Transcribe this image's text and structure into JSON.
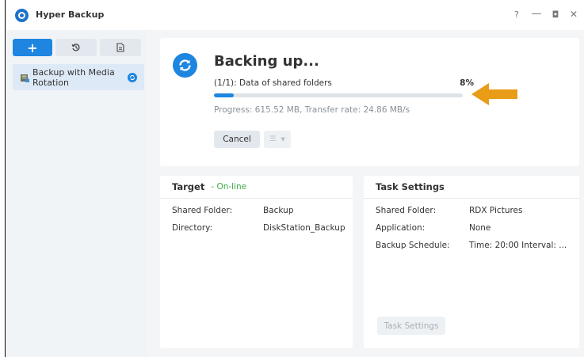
{
  "window": {
    "title": "Hyper Backup",
    "help": "?",
    "minimize": "—",
    "maximize": "◘",
    "close": "✕"
  },
  "sidebar": {
    "add_label": "+",
    "task": {
      "label": "Backup with Media Rotation",
      "status": "running"
    }
  },
  "progress": {
    "title": "Backing up...",
    "task_desc": "(1/1): Data of shared folders",
    "percent_text": "8%",
    "percent_value": 8,
    "detail": "Progress: 615.52 MB, Transfer rate: 24.86 MB/s",
    "cancel_label": "Cancel"
  },
  "target": {
    "title": "Target",
    "status": "- On-line",
    "rows": [
      {
        "key": "Shared Folder:",
        "value": "Backup"
      },
      {
        "key": "Directory:",
        "value": "DiskStation_Backup"
      }
    ]
  },
  "task_settings": {
    "title": "Task Settings",
    "rows": [
      {
        "key": "Shared Folder:",
        "value": "RDX Pictures"
      },
      {
        "key": "Application:",
        "value": "None"
      },
      {
        "key": "Backup Schedule:",
        "value": "Time: 20:00 Interval: ..."
      }
    ],
    "button_label": "Task Settings"
  },
  "colors": {
    "accent": "#1e86e0",
    "online": "#39a845",
    "arrow": "#e89c18"
  }
}
